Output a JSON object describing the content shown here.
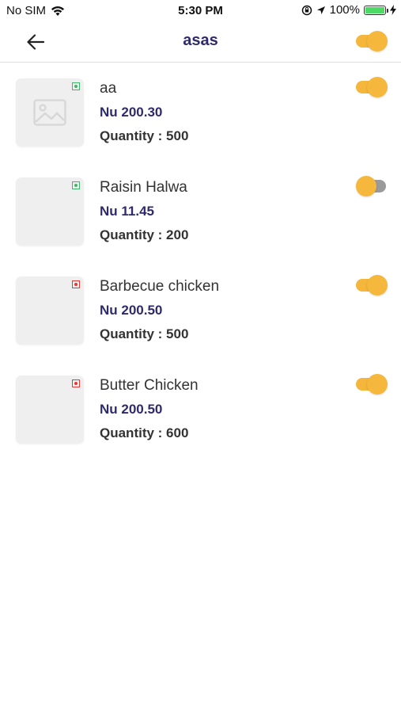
{
  "status_bar": {
    "carrier": "No SIM",
    "time": "5:30 PM",
    "battery": "100%"
  },
  "header": {
    "title": "asas",
    "toggle_on": true
  },
  "colors": {
    "accent": "#f4b63b",
    "title": "#2e2a6b",
    "veg": "#3db868",
    "nonveg": "#e53935"
  },
  "items": [
    {
      "name": "aa",
      "price": "Nu 200.30",
      "quantity": "Quantity : 500",
      "type": "veg",
      "has_placeholder_icon": true,
      "available": true
    },
    {
      "name": "Raisin Halwa",
      "price": "Nu 11.45",
      "quantity": "Quantity : 200",
      "type": "veg",
      "has_placeholder_icon": false,
      "available": false
    },
    {
      "name": "Barbecue chicken",
      "price": "Nu 200.50",
      "quantity": "Quantity : 500",
      "type": "nonveg",
      "has_placeholder_icon": false,
      "available": true
    },
    {
      "name": "Butter Chicken",
      "price": "Nu 200.50",
      "quantity": "Quantity : 600",
      "type": "nonveg",
      "has_placeholder_icon": false,
      "available": true
    }
  ]
}
